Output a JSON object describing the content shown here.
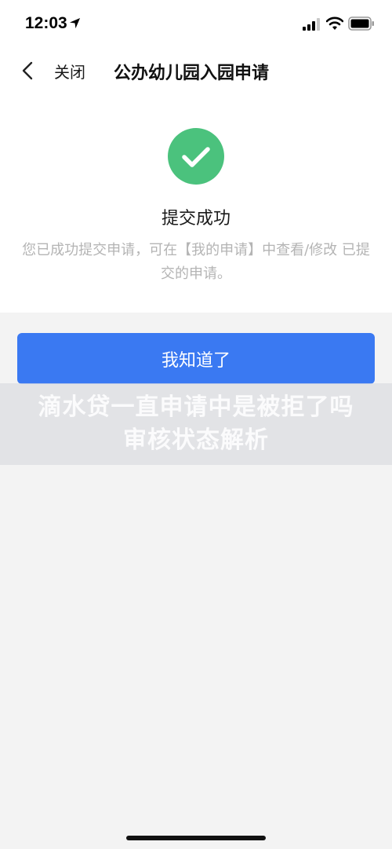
{
  "status_bar": {
    "time": "12:03",
    "location_icon": "location-arrow-icon",
    "signal_icon": "cellular-signal-icon",
    "wifi_icon": "wifi-icon",
    "battery_icon": "battery-icon"
  },
  "nav": {
    "back_icon": "chevron-left-icon",
    "close_label": "关闭",
    "title": "公办幼儿园入园申请"
  },
  "result": {
    "icon": "check-circle-icon",
    "icon_color": "#4bc27d",
    "title": "提交成功",
    "description": "您已成功提交申请，可在【我的申请】中查看/修改 已提交的申请。"
  },
  "actions": {
    "ack_label": "我知道了",
    "ack_color": "#3a79f2"
  },
  "watermark": {
    "text": "滴水贷一直申请中是被拒了吗审核状态解析"
  }
}
